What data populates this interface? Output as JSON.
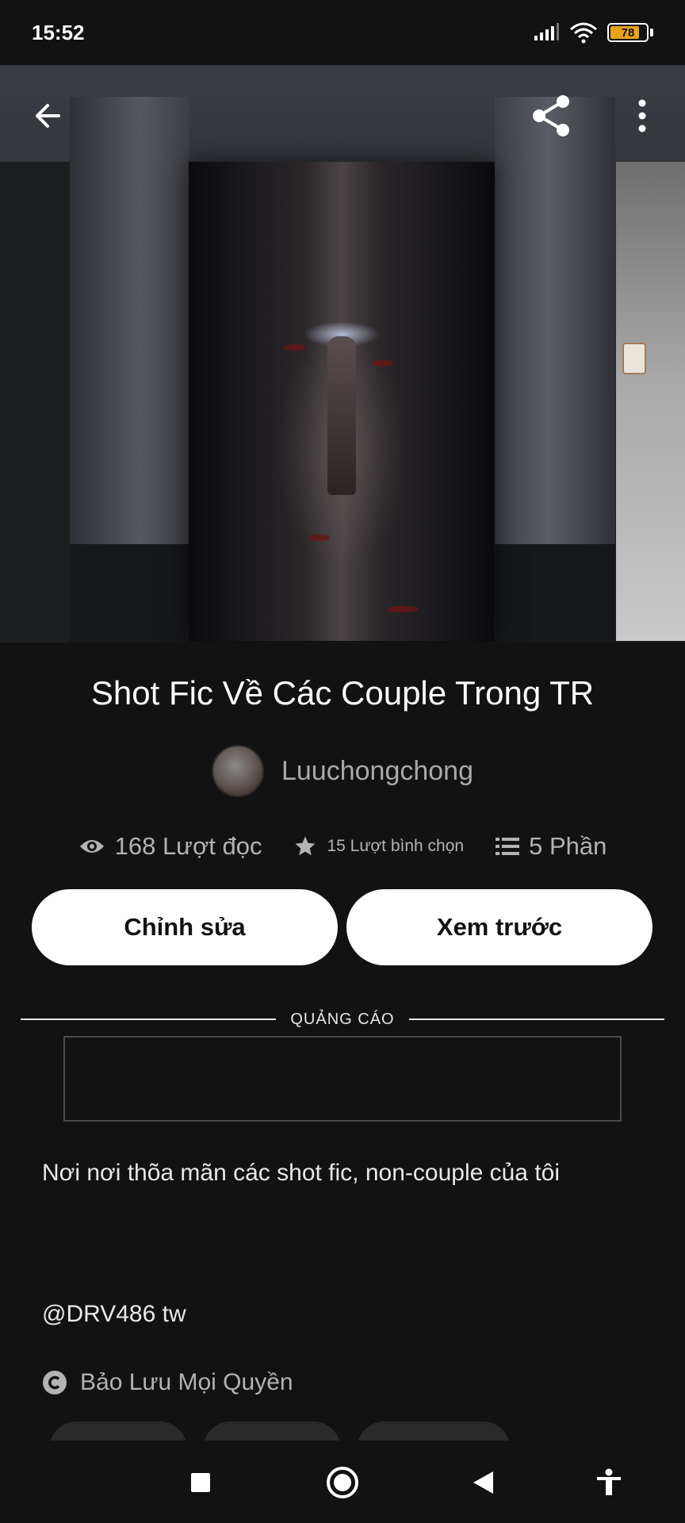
{
  "status_bar": {
    "time": "15:52",
    "battery_level": "78",
    "battery_color": "#e8a21d"
  },
  "header": {
    "back_icon": "arrow-left-icon",
    "share_icon": "share-icon",
    "more_icon": "more-vertical-icon"
  },
  "story": {
    "title": "Shot Fic Về Các Couple Trong TR",
    "author": "Luuchongchong",
    "stats": {
      "reads": "168 Lượt đọc",
      "votes": "15 Lượt bình chọn",
      "parts": "5 Phần"
    }
  },
  "actions": {
    "edit_label": "Chỉnh sửa",
    "preview_label": "Xem trước"
  },
  "ad": {
    "label": "QUẢNG CÁO"
  },
  "description": "Nơi nơi thõa mãn các shot fic, non-couple của tôi",
  "tag_line": "@DRV486 tw",
  "copyright": "Bảo Lưu Mọi Quyền",
  "nav": {
    "recents_icon": "square-icon",
    "home_icon": "circle-home-icon",
    "back_icon": "triangle-back-icon",
    "accessibility_icon": "accessibility-icon"
  }
}
